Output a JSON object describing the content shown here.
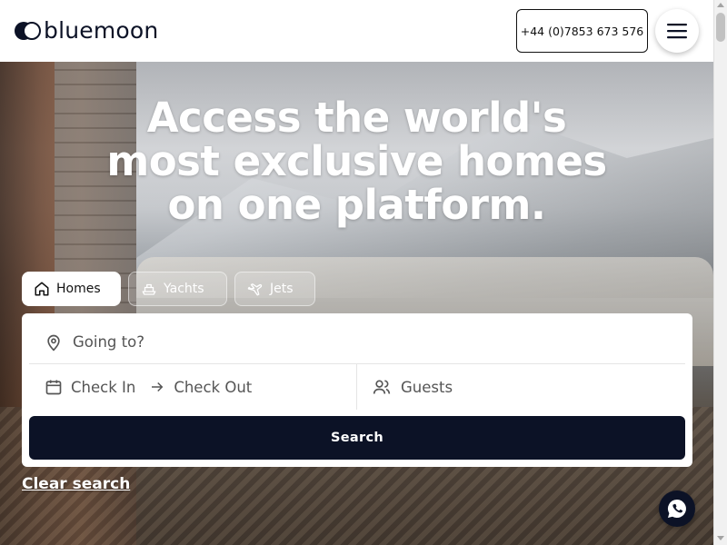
{
  "header": {
    "logo_text": "bluemoon",
    "phone": "+44 (0)7853 673 576",
    "menu_icon": "hamburger-menu-icon"
  },
  "hero": {
    "headline": "Access the world's most exclusive homes on one platform."
  },
  "tabs": [
    {
      "label": "Homes",
      "icon": "home-icon",
      "active": true
    },
    {
      "label": "Yachts",
      "icon": "yacht-icon",
      "active": false
    },
    {
      "label": "Jets",
      "icon": "plane-icon",
      "active": false
    }
  ],
  "search": {
    "destination_placeholder": "Going to?",
    "check_in": "Check In",
    "check_out": "Check Out",
    "guests": "Guests",
    "button": "Search",
    "clear": "Clear search"
  },
  "colors": {
    "brand_dark": "#0c1226",
    "white": "#ffffff"
  }
}
